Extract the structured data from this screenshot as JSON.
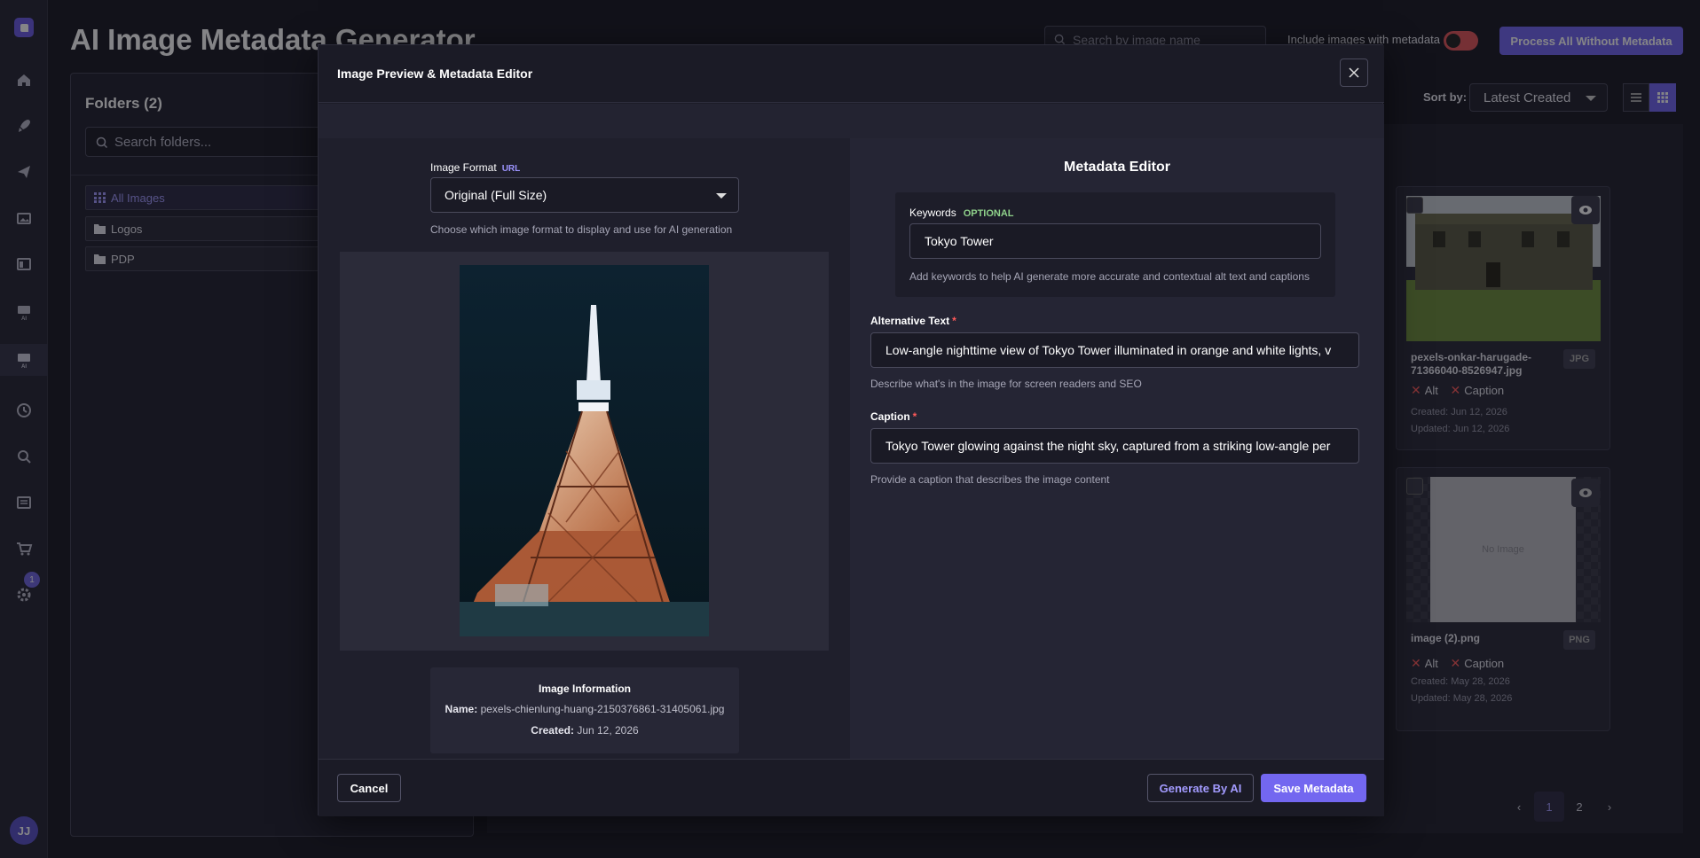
{
  "page": {
    "title": "AI Image Metadata Generator",
    "search_placeholder": "Search by image name",
    "include_label": "Include images with metadata",
    "process_button": "Process All Without Metadata",
    "sort_label": "Sort by:",
    "sort_value": "Latest Created"
  },
  "sidebar": {
    "badge_count": "1",
    "avatar_initials": "JJ",
    "icons": [
      "home-icon",
      "rocket-icon",
      "send-icon",
      "images-icon",
      "layout-icon",
      "ai-image-icon",
      "ai-image-active-icon",
      "history-icon",
      "search-icon",
      "list-icon",
      "cart-icon",
      "settings-icon"
    ]
  },
  "folders": {
    "title": "Folders (2)",
    "search_placeholder": "Search folders...",
    "items": [
      {
        "label": "All Images",
        "active": true
      },
      {
        "label": "Logos",
        "active": false
      },
      {
        "label": "PDP",
        "active": false
      }
    ]
  },
  "cards": [
    {
      "name": "pexels-onkar-harugade-71366040-8526947.jpg",
      "type": "JPG",
      "alt_label": "Alt",
      "caption_label": "Caption",
      "created": "Created: Jun 12, 2026",
      "updated": "Updated: Jun 12, 2026"
    },
    {
      "name": "image (2).png",
      "type": "PNG",
      "no_image": "No Image",
      "alt_label": "Alt",
      "caption_label": "Caption",
      "created": "Created: May 28, 2026",
      "updated": "Updated: May 28, 2026"
    }
  ],
  "pagination": {
    "pages": [
      "1",
      "2"
    ],
    "current": "1"
  },
  "modal": {
    "title": "Image Preview & Metadata Editor",
    "format_label": "Image Format",
    "format_badge": "URL",
    "format_value": "Original (Full Size)",
    "format_help": "Choose which image format to display and use for AI generation",
    "info_title": "Image Information",
    "info_name_label": "Name:",
    "info_name": "pexels-chienlung-huang-2150376861-31405061.jpg",
    "info_created_label": "Created:",
    "info_created": "Jun 12, 2026",
    "editor_title": "Metadata Editor",
    "keywords_label": "Keywords",
    "keywords_badge": "OPTIONAL",
    "keywords_value": "Tokyo Tower",
    "keywords_help": "Add keywords to help AI generate more accurate and contextual alt text and captions",
    "alt_label": "Alternative Text",
    "alt_value": "Low-angle nighttime view of Tokyo Tower illuminated in orange and white lights, v",
    "alt_help": "Describe what's in the image for screen readers and SEO",
    "caption_label": "Caption",
    "caption_value": "Tokyo Tower glowing against the night sky, captured from a striking low-angle per",
    "caption_help": "Provide a caption that describes the image content",
    "required_mark": "*",
    "cancel": "Cancel",
    "generate": "Generate By AI",
    "save": "Save Metadata"
  },
  "colors": {
    "accent": "#7367f0",
    "danger": "#ff5a5a",
    "optional": "#8ed08a"
  }
}
